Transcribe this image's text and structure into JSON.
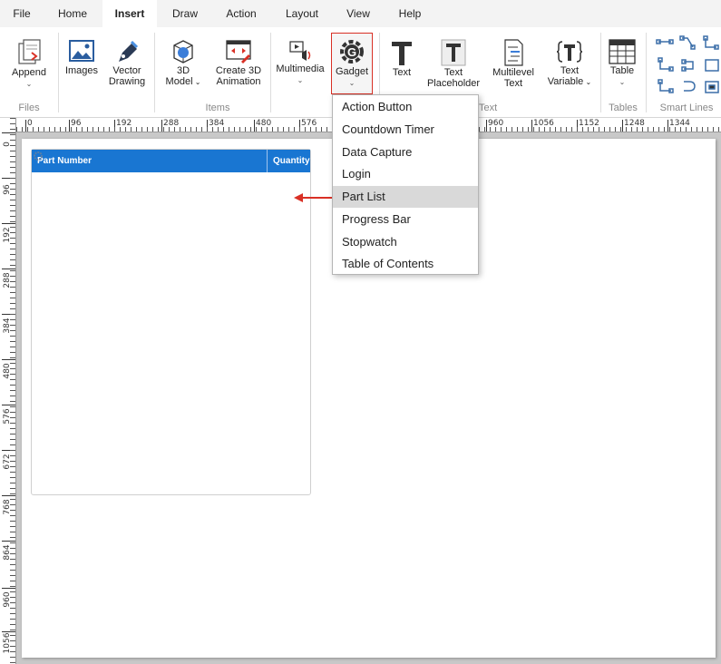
{
  "menu": {
    "tabs": [
      "File",
      "Home",
      "Insert",
      "Draw",
      "Action",
      "Layout",
      "View",
      "Help"
    ],
    "active": "Insert"
  },
  "ribbon": {
    "append": "Append",
    "images": "Images",
    "vector_line1": "Vector",
    "vector_line2": "Drawing",
    "model_line1": "3D",
    "model_line2": "Model",
    "anim_line1": "Create 3D",
    "anim_line2": "Animation",
    "multimedia": "Multimedia",
    "gadget": "Gadget",
    "text": "Text",
    "text_ph_line1": "Text",
    "text_ph_line2": "Placeholder",
    "multilevel_line1": "Multilevel",
    "multilevel_line2": "Text",
    "textvar_line1": "Text",
    "textvar_line2": "Variable",
    "table": "Table",
    "groups": {
      "files": "Files",
      "items": "Items",
      "text": "Text",
      "tables": "Tables",
      "smart_lines": "Smart Lines"
    }
  },
  "ruler": {
    "h_labels": [
      "0",
      "96",
      "192",
      "288",
      "384",
      "480",
      "576",
      "960",
      "1056",
      "1152",
      "1248",
      "1344"
    ],
    "v_labels": [
      "0",
      "96",
      "192",
      "288",
      "384",
      "480",
      "576",
      "672",
      "768",
      "864",
      "960",
      "1056"
    ]
  },
  "partlist": {
    "col_part": "Part Number",
    "col_qty": "Quantity"
  },
  "dropdown": {
    "items": [
      "Action Button",
      "Countdown Timer",
      "Data Capture",
      "Login",
      "Part List",
      "Progress Bar",
      "Stopwatch",
      "Table of Contents"
    ],
    "highlighted": "Part List"
  },
  "colors": {
    "accent": "#1976d2",
    "arrow": "#d93025",
    "highlight": "#d9d9d9"
  }
}
